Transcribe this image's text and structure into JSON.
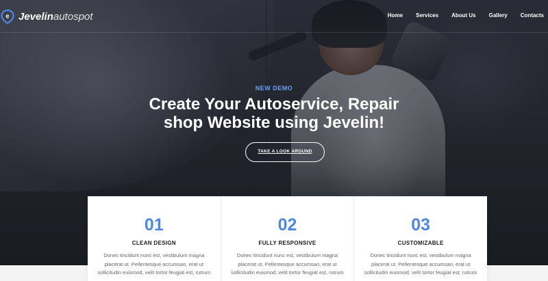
{
  "brand": {
    "name": "Jevelin",
    "suffix": "autospot",
    "icon": "jevelin-logo-icon",
    "accent": "#4f86e6"
  },
  "nav": {
    "items": [
      "Home",
      "Services",
      "About Us",
      "Gallery",
      "Contacts"
    ]
  },
  "hero": {
    "eyebrow": "NEW DEMO",
    "headline_line1": "Create Your Autoservice, Repair",
    "headline_line2": "shop Website using Jevelin!",
    "cta_label": "TAKE A LOOK AROUND"
  },
  "features": [
    {
      "number": "01",
      "title": "CLEAN DESIGN",
      "text": "Donec tincidunt nunc est, vestibulum magna placerat ut. Pellentesque accumsan, erat ut sollicitudin euismod, velit tortor feugiat est, rutrum"
    },
    {
      "number": "02",
      "title": "FULLY RESPONSIVE",
      "text": "Donec tincidunt nunc est, vestibulum magna placerat ut. Pellentesque accumsan, erat ut sollicitudin euismod, velit tortor feugiat est, rutrum"
    },
    {
      "number": "03",
      "title": "CUSTOMIZABLE",
      "text": "Donec tincidunt nunc est, vestibulum magna placerat ut. Pellentesque accumsan, erat ut sollicitudin euismod, velit tortor feugiat est, rutrum"
    }
  ]
}
